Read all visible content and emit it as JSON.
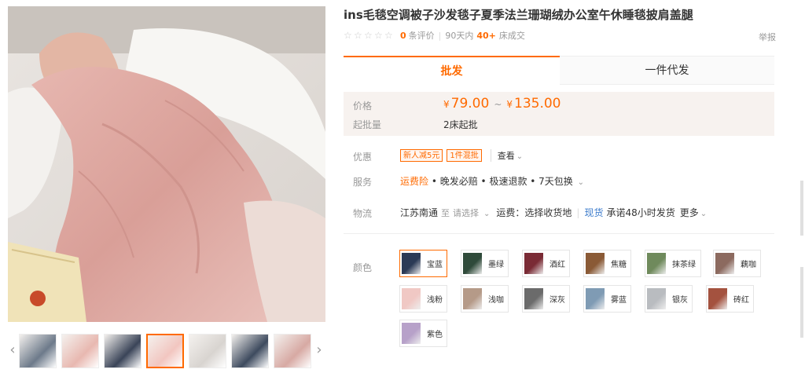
{
  "product": {
    "title": "ins毛毯空调被子沙发毯子夏季法兰珊瑚绒办公室午休睡毯披肩盖腿",
    "reviews_count": "0",
    "reviews_label": "条评价",
    "period": "90天内",
    "sold_count": "40+",
    "sold_label": "床成交",
    "report": "举报"
  },
  "tabs": {
    "wholesale": "批发",
    "dropship": "一件代发"
  },
  "price": {
    "label": "价格",
    "currency": "¥",
    "min": "79.00",
    "separator": "~",
    "max": "135.00",
    "moq_label": "起批量",
    "moq_value": "2床起批"
  },
  "promo": {
    "label": "优惠",
    "tags": [
      "新人减5元",
      "1件混批"
    ],
    "view": "查看"
  },
  "service": {
    "label": "服务",
    "highlight": "运费险",
    "items": "• 晚发必赔 • 极速退款 • 7天包换"
  },
  "logistics": {
    "label": "物流",
    "origin": "江苏南通",
    "to": "至",
    "select": "请选择",
    "fee": "运费：选择收货地",
    "stock": "现货",
    "promise": "承诺48小时发货",
    "more": "更多"
  },
  "colors": {
    "label": "颜色",
    "options": [
      "宝蓝",
      "墨绿",
      "酒红",
      "焦糖",
      "抹茶绿",
      "藕咖",
      "浅粉",
      "浅咖",
      "深灰",
      "雾蓝",
      "银灰",
      "砖红",
      "紫色"
    ],
    "swatch_colors": [
      "#2b3a55",
      "#2f4a3a",
      "#7a2b35",
      "#8a5a36",
      "#6f8a5c",
      "#8c6a5f",
      "#f0c8c4",
      "#b59a88",
      "#6b6b6b",
      "#7f9bb4",
      "#b9bcc0",
      "#a4523f",
      "#b7a1c9"
    ],
    "selected": "宝蓝"
  },
  "gallery": {
    "thumb_colors": [
      "#6d7a8a",
      "#e8b8b0",
      "#3a4458",
      "#f2c6c0",
      "#d8d4d0",
      "#3d4a5e",
      "#d7a9a3"
    ]
  }
}
